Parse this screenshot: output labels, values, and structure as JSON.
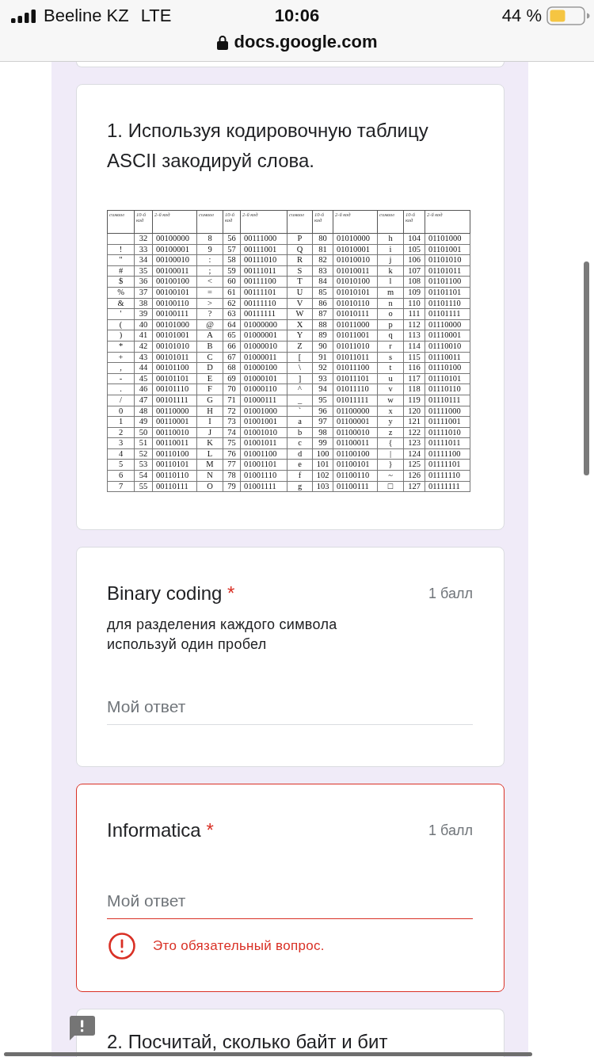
{
  "status_bar": {
    "carrier": "Beeline KZ",
    "network": "LTE",
    "time": "10:06",
    "battery": "44 %"
  },
  "address_bar": {
    "url": "docs.google.com"
  },
  "questions": [
    {
      "kind": "image",
      "title": "1. Используя кодировочную таблицу ASCII закодируй слова.",
      "ascii_table": {
        "columns": [
          "символ",
          "10-й код",
          "2-й код",
          "символ",
          "10-й код",
          "2-й код",
          "символ",
          "10-й код",
          "2-й код",
          "символ",
          "10-й код",
          "2-й код"
        ],
        "groups": [
          [
            {
              "decimal": "32",
              "binary": "00100000"
            },
            {
              "symbol": "!",
              "decimal": "33",
              "binary": "00100001"
            },
            {
              "symbol": "\"",
              "decimal": "34",
              "binary": "00100010"
            },
            {
              "symbol": "#",
              "decimal": "35",
              "binary": "00100011"
            },
            {
              "symbol": "$",
              "decimal": "36",
              "binary": "00100100"
            },
            {
              "symbol": "%",
              "decimal": "37",
              "binary": "00100101"
            },
            {
              "symbol": "&",
              "decimal": "38",
              "binary": "00100110"
            },
            {
              "symbol": "'",
              "decimal": "39",
              "binary": "00100111"
            },
            {
              "symbol": "(",
              "decimal": "40",
              "binary": "00101000"
            },
            {
              "symbol": ")",
              "decimal": "41",
              "binary": "00101001"
            },
            {
              "symbol": "*",
              "decimal": "42",
              "binary": "00101010"
            },
            {
              "symbol": "+",
              "decimal": "43",
              "binary": "00101011"
            },
            {
              "symbol": ",",
              "decimal": "44",
              "binary": "00101100"
            },
            {
              "symbol": "-",
              "decimal": "45",
              "binary": "00101101"
            },
            {
              "symbol": ".",
              "decimal": "46",
              "binary": "00101110"
            },
            {
              "symbol": "/",
              "decimal": "47",
              "binary": "00101111"
            },
            {
              "symbol": "0",
              "decimal": "48",
              "binary": "00110000"
            },
            {
              "symbol": "1",
              "decimal": "49",
              "binary": "00110001"
            },
            {
              "symbol": "2",
              "decimal": "50",
              "binary": "00110010"
            },
            {
              "symbol": "3",
              "decimal": "51",
              "binary": "00110011"
            },
            {
              "symbol": "4",
              "decimal": "52",
              "binary": "00110100"
            },
            {
              "symbol": "5",
              "decimal": "53",
              "binary": "00110101"
            },
            {
              "symbol": "6",
              "decimal": "54",
              "binary": "00110110"
            },
            {
              "symbol": "7",
              "decimal": "55",
              "binary": "00110111"
            }
          ],
          [
            {
              "symbol": "8",
              "decimal": "56",
              "binary": "00111000"
            },
            {
              "symbol": "9",
              "decimal": "57",
              "binary": "00111001"
            },
            {
              "symbol": ":",
              "decimal": "58",
              "binary": "00111010"
            },
            {
              "symbol": ";",
              "decimal": "59",
              "binary": "00111011"
            },
            {
              "symbol": "<",
              "decimal": "60",
              "binary": "00111100"
            },
            {
              "symbol": "=",
              "decimal": "61",
              "binary": "00111101"
            },
            {
              "symbol": ">",
              "decimal": "62",
              "binary": "00111110"
            },
            {
              "symbol": "?",
              "decimal": "63",
              "binary": "00111111"
            },
            {
              "symbol": "@",
              "decimal": "64",
              "binary": "01000000"
            },
            {
              "symbol": "A",
              "decimal": "65",
              "binary": "01000001"
            },
            {
              "symbol": "B",
              "decimal": "66",
              "binary": "01000010"
            },
            {
              "symbol": "C",
              "decimal": "67",
              "binary": "01000011"
            },
            {
              "symbol": "D",
              "decimal": "68",
              "binary": "01000100"
            },
            {
              "symbol": "E",
              "decimal": "69",
              "binary": "01000101"
            },
            {
              "symbol": "F",
              "decimal": "70",
              "binary": "01000110"
            },
            {
              "symbol": "G",
              "decimal": "71",
              "binary": "01000111"
            },
            {
              "symbol": "H",
              "decimal": "72",
              "binary": "01001000"
            },
            {
              "symbol": "I",
              "decimal": "73",
              "binary": "01001001"
            },
            {
              "symbol": "J",
              "decimal": "74",
              "binary": "01001010"
            },
            {
              "symbol": "K",
              "decimal": "75",
              "binary": "01001011"
            },
            {
              "symbol": "L",
              "decimal": "76",
              "binary": "01001100"
            },
            {
              "symbol": "M",
              "decimal": "77",
              "binary": "01001101"
            },
            {
              "symbol": "N",
              "decimal": "78",
              "binary": "01001110"
            },
            {
              "symbol": "O",
              "decimal": "79",
              "binary": "01001111"
            }
          ],
          [
            {
              "symbol": "P",
              "decimal": "80",
              "binary": "01010000"
            },
            {
              "symbol": "Q",
              "decimal": "81",
              "binary": "01010001"
            },
            {
              "symbol": "R",
              "decimal": "82",
              "binary": "01010010"
            },
            {
              "symbol": "S",
              "decimal": "83",
              "binary": "01010011"
            },
            {
              "symbol": "T",
              "decimal": "84",
              "binary": "01010100"
            },
            {
              "symbol": "U",
              "decimal": "85",
              "binary": "01010101"
            },
            {
              "symbol": "V",
              "decimal": "86",
              "binary": "01010110"
            },
            {
              "symbol": "W",
              "decimal": "87",
              "binary": "01010111"
            },
            {
              "symbol": "X",
              "decimal": "88",
              "binary": "01011000"
            },
            {
              "symbol": "Y",
              "decimal": "89",
              "binary": "01011001"
            },
            {
              "symbol": "Z",
              "decimal": "90",
              "binary": "01011010"
            },
            {
              "symbol": "[",
              "decimal": "91",
              "binary": "01011011"
            },
            {
              "symbol": "\\",
              "decimal": "92",
              "binary": "01011100"
            },
            {
              "symbol": "]",
              "decimal": "93",
              "binary": "01011101"
            },
            {
              "symbol": "^",
              "decimal": "94",
              "binary": "01011110"
            },
            {
              "symbol": "_",
              "decimal": "95",
              "binary": "01011111"
            },
            {
              "symbol": "`",
              "decimal": "96",
              "binary": "01100000"
            },
            {
              "symbol": "a",
              "decimal": "97",
              "binary": "01100001"
            },
            {
              "symbol": "b",
              "decimal": "98",
              "binary": "01100010"
            },
            {
              "symbol": "c",
              "decimal": "99",
              "binary": "01100011"
            },
            {
              "symbol": "d",
              "decimal": "100",
              "binary": "01100100"
            },
            {
              "symbol": "e",
              "decimal": "101",
              "binary": "01100101"
            },
            {
              "symbol": "f",
              "decimal": "102",
              "binary": "01100110"
            },
            {
              "symbol": "g",
              "decimal": "103",
              "binary": "01100111"
            }
          ],
          [
            {
              "symbol": "h",
              "decimal": "104",
              "binary": "01101000"
            },
            {
              "symbol": "i",
              "decimal": "105",
              "binary": "01101001"
            },
            {
              "symbol": "j",
              "decimal": "106",
              "binary": "01101010"
            },
            {
              "symbol": "k",
              "decimal": "107",
              "binary": "01101011"
            },
            {
              "symbol": "l",
              "decimal": "108",
              "binary": "01101100"
            },
            {
              "symbol": "m",
              "decimal": "109",
              "binary": "01101101"
            },
            {
              "symbol": "n",
              "decimal": "110",
              "binary": "01101110"
            },
            {
              "symbol": "o",
              "decimal": "111",
              "binary": "01101111"
            },
            {
              "symbol": "p",
              "decimal": "112",
              "binary": "01110000"
            },
            {
              "symbol": "q",
              "decimal": "113",
              "binary": "01110001"
            },
            {
              "symbol": "r",
              "decimal": "114",
              "binary": "01110010"
            },
            {
              "symbol": "s",
              "decimal": "115",
              "binary": "01110011"
            },
            {
              "symbol": "t",
              "decimal": "116",
              "binary": "01110100"
            },
            {
              "symbol": "u",
              "decimal": "117",
              "binary": "01110101"
            },
            {
              "symbol": "v",
              "decimal": "118",
              "binary": "01110110"
            },
            {
              "symbol": "w",
              "decimal": "119",
              "binary": "01110111"
            },
            {
              "symbol": "x",
              "decimal": "120",
              "binary": "01111000"
            },
            {
              "symbol": "y",
              "decimal": "121",
              "binary": "01111001"
            },
            {
              "symbol": "z",
              "decimal": "122",
              "binary": "01111010"
            },
            {
              "symbol": "{",
              "decimal": "123",
              "binary": "01111011"
            },
            {
              "symbol": "|",
              "decimal": "124",
              "binary": "01111100"
            },
            {
              "symbol": "}",
              "decimal": "125",
              "binary": "01111101"
            },
            {
              "symbol": "~",
              "decimal": "126",
              "binary": "01111110"
            },
            {
              "symbol": "□",
              "decimal": "127",
              "binary": "01111111"
            }
          ]
        ]
      }
    },
    {
      "kind": "short_answer",
      "title": "Binary coding",
      "required_mark": "*",
      "points": "1 балл",
      "description": "для разделения каждого символа используй один пробел",
      "placeholder": "Мой ответ",
      "invalid": false
    },
    {
      "kind": "short_answer",
      "title": "Informatica",
      "required_mark": "*",
      "points": "1 балл",
      "placeholder": "Мой ответ",
      "invalid": true,
      "error": "Это обязательный вопрос."
    },
    {
      "kind": "text",
      "title": "2. Посчитай, сколько байт и бит"
    }
  ]
}
